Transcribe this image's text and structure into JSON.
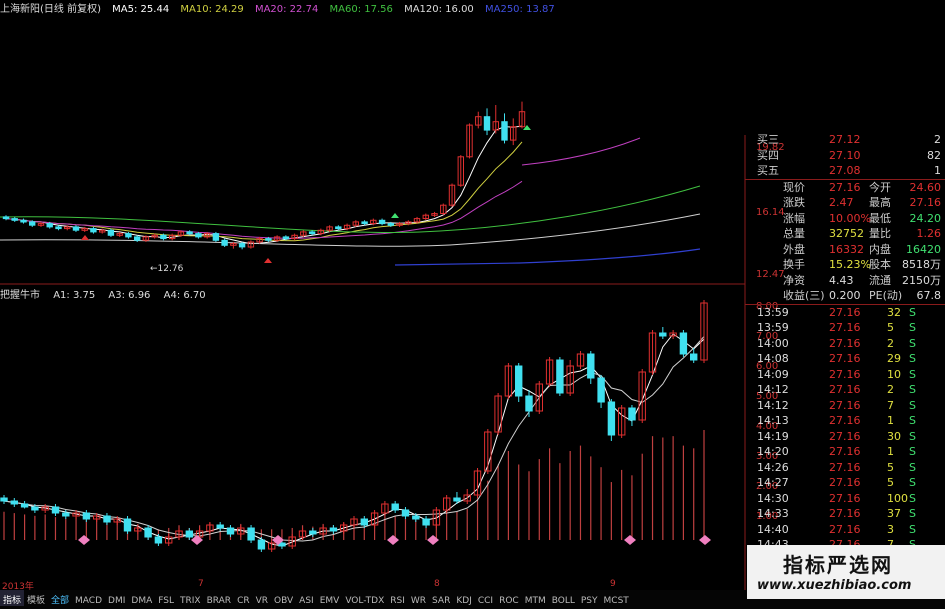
{
  "header": {
    "stock": "上海新阳(日线 前复权)",
    "ma5": "MA5: 25.44",
    "ma10": "MA10: 24.29",
    "ma20": "MA20: 22.74",
    "ma60": "MA60: 17.56",
    "ma120": "MA120: 16.00",
    "ma250": "MA250: 13.87"
  },
  "indicator_header": {
    "name": "把握牛市",
    "a1": "A1: 3.75",
    "a3": "A3: 6.96",
    "a4": "A4: 6.70"
  },
  "colors": {
    "up": "#e03030",
    "down": "#40e0f0",
    "ma5": "#ffffff",
    "ma10": "#d0d040",
    "ma20": "#c040c0",
    "ma60": "#40c040",
    "ma120": "#d0d0d0",
    "ma250": "#3040d0",
    "grid_line": "#8a1b1b"
  },
  "price_axis": [
    "19.82",
    "16.14",
    "12.47"
  ],
  "low_marker": "←12.76",
  "indicator_axis": [
    "8.00",
    "7.00",
    "6.00",
    "5.00",
    "4.00",
    "3.00",
    "2.00",
    "1.00"
  ],
  "x_labels": [
    "2013年",
    "7",
    "8",
    "9"
  ],
  "order_book": [
    {
      "label": "买三",
      "price": "27.12",
      "vol": "2"
    },
    {
      "label": "买四",
      "price": "27.10",
      "vol": "82"
    },
    {
      "label": "买五",
      "price": "27.08",
      "vol": "1"
    }
  ],
  "quote": [
    {
      "l1": "现价",
      "v1": "27.16",
      "l2": "今开",
      "v2": "24.60"
    },
    {
      "l1": "涨跌",
      "v1": "2.47",
      "l2": "最高",
      "v2": "27.16"
    },
    {
      "l1": "涨幅",
      "v1": "10.00%",
      "l2": "最低",
      "v2": "24.20"
    },
    {
      "l1": "总量",
      "v1": "32752",
      "l2": "量比",
      "v2": "1.26"
    },
    {
      "l1": "外盘",
      "v1": "16332",
      "l2": "内盘",
      "v2": "16420"
    },
    {
      "l1": "换手",
      "v1": "15.23%",
      "l2": "股本",
      "v2": "8518万"
    },
    {
      "l1": "净资",
      "v1": "4.43",
      "l2": "流通",
      "v2": "2150万"
    },
    {
      "l1": "收益(三)",
      "v1": "0.200",
      "l2": "PE(动)",
      "v2": "67.8"
    }
  ],
  "ticks": [
    {
      "time": "13:59",
      "price": "27.16",
      "vol": "32",
      "flag": "S"
    },
    {
      "time": "13:59",
      "price": "27.16",
      "vol": "5",
      "flag": "S"
    },
    {
      "time": "14:00",
      "price": "27.16",
      "vol": "2",
      "flag": "S"
    },
    {
      "time": "14:08",
      "price": "27.16",
      "vol": "29",
      "flag": "S"
    },
    {
      "time": "14:09",
      "price": "27.16",
      "vol": "10",
      "flag": "S"
    },
    {
      "time": "14:12",
      "price": "27.16",
      "vol": "2",
      "flag": "S"
    },
    {
      "time": "14:12",
      "price": "27.16",
      "vol": "7",
      "flag": "S"
    },
    {
      "time": "14:13",
      "price": "27.16",
      "vol": "1",
      "flag": "S"
    },
    {
      "time": "14:19",
      "price": "27.16",
      "vol": "30",
      "flag": "S"
    },
    {
      "time": "14:20",
      "price": "27.16",
      "vol": "1",
      "flag": "S"
    },
    {
      "time": "14:26",
      "price": "27.16",
      "vol": "5",
      "flag": "S"
    },
    {
      "time": "14:27",
      "price": "27.16",
      "vol": "5",
      "flag": "S"
    },
    {
      "time": "14:30",
      "price": "27.16",
      "vol": "100",
      "flag": "S"
    },
    {
      "time": "14:33",
      "price": "27.16",
      "vol": "37",
      "flag": "S"
    },
    {
      "time": "14:40",
      "price": "27.16",
      "vol": "3",
      "flag": "S"
    },
    {
      "time": "14:43",
      "price": "27.16",
      "vol": "7",
      "flag": "S"
    }
  ],
  "tabs": [
    "指标",
    "模板",
    "全部",
    "MACD",
    "DMI",
    "DMA",
    "FSL",
    "TRIX",
    "BRAR",
    "CR",
    "VR",
    "OBV",
    "ASI",
    "EMV",
    "VOL-TDX",
    "RSI",
    "WR",
    "SAR",
    "KDJ",
    "CCI",
    "ROC",
    "MTM",
    "BOLL",
    "PSY",
    "MCST"
  ],
  "watermark": {
    "title": "指标严选网",
    "url": "www.xuezhibiao.com"
  },
  "chart_data": {
    "type": "candlestick",
    "dates_shown": [
      "2013年",
      "7",
      "8",
      "9"
    ],
    "price_axis_ticks": [
      12.47,
      16.14,
      19.82
    ],
    "price_candles": [
      [
        14.7,
        14.6,
        14.8,
        14.5
      ],
      [
        14.6,
        14.5,
        14.7,
        14.4
      ],
      [
        14.5,
        14.4,
        14.6,
        14.3
      ],
      [
        14.4,
        14.2,
        14.5,
        14.1
      ],
      [
        14.2,
        14.3,
        14.4,
        14.1
      ],
      [
        14.3,
        14.1,
        14.4,
        14.0
      ],
      [
        14.1,
        14.0,
        14.2,
        13.9
      ],
      [
        14.0,
        14.1,
        14.2,
        13.9
      ],
      [
        14.1,
        13.9,
        14.2,
        13.8
      ],
      [
        13.9,
        14.0,
        14.1,
        13.8
      ],
      [
        14.0,
        13.8,
        14.1,
        13.7
      ],
      [
        13.8,
        13.9,
        14.0,
        13.7
      ],
      [
        13.9,
        13.6,
        14.0,
        13.5
      ],
      [
        13.6,
        13.7,
        13.8,
        13.5
      ],
      [
        13.7,
        13.5,
        13.8,
        13.4
      ],
      [
        13.5,
        13.3,
        13.6,
        13.2
      ],
      [
        13.3,
        13.5,
        13.6,
        13.2
      ],
      [
        13.5,
        13.6,
        13.7,
        13.4
      ],
      [
        13.6,
        13.4,
        13.7,
        13.3
      ],
      [
        13.4,
        13.6,
        13.7,
        13.3
      ],
      [
        13.6,
        13.8,
        13.9,
        13.5
      ],
      [
        13.8,
        13.7,
        13.9,
        13.6
      ],
      [
        13.7,
        13.5,
        13.8,
        13.4
      ],
      [
        13.5,
        13.7,
        13.8,
        13.4
      ],
      [
        13.7,
        13.3,
        13.8,
        13.2
      ],
      [
        13.3,
        13.0,
        13.4,
        12.9
      ],
      [
        13.0,
        13.1,
        13.2,
        12.8
      ],
      [
        13.1,
        12.9,
        13.2,
        12.76
      ],
      [
        12.9,
        13.2,
        13.3,
        12.8
      ],
      [
        13.2,
        13.4,
        13.5,
        13.1
      ],
      [
        13.4,
        13.3,
        13.5,
        13.2
      ],
      [
        13.3,
        13.5,
        13.6,
        13.2
      ],
      [
        13.5,
        13.4,
        13.6,
        13.3
      ],
      [
        13.4,
        13.6,
        13.7,
        13.3
      ],
      [
        13.6,
        13.8,
        13.9,
        13.5
      ],
      [
        13.8,
        13.7,
        13.9,
        13.6
      ],
      [
        13.7,
        13.9,
        14.0,
        13.6
      ],
      [
        13.9,
        14.1,
        14.2,
        13.8
      ],
      [
        14.1,
        14.0,
        14.2,
        13.9
      ],
      [
        14.0,
        14.2,
        14.3,
        13.9
      ],
      [
        14.2,
        14.4,
        14.5,
        14.1
      ],
      [
        14.4,
        14.3,
        14.5,
        14.2
      ],
      [
        14.3,
        14.5,
        14.6,
        14.2
      ],
      [
        14.5,
        14.3,
        14.6,
        14.2
      ],
      [
        14.3,
        14.2,
        14.4,
        14.1
      ],
      [
        14.2,
        14.3,
        14.4,
        14.1
      ],
      [
        14.3,
        14.4,
        14.5,
        14.2
      ],
      [
        14.4,
        14.6,
        14.7,
        14.3
      ],
      [
        14.6,
        14.8,
        14.9,
        14.5
      ],
      [
        14.8,
        14.9,
        15.0,
        14.7
      ],
      [
        14.9,
        15.4,
        15.5,
        14.8
      ],
      [
        15.4,
        16.6,
        16.7,
        15.3
      ],
      [
        16.6,
        18.3,
        18.4,
        16.5
      ],
      [
        18.3,
        20.2,
        20.3,
        18.2
      ],
      [
        20.2,
        20.7,
        21.0,
        20.0
      ],
      [
        20.7,
        19.9,
        21.2,
        19.6
      ],
      [
        19.9,
        20.4,
        21.4,
        19.7
      ],
      [
        20.4,
        19.3,
        20.9,
        19.1
      ],
      [
        19.3,
        20.1,
        20.6,
        19.0
      ],
      [
        20.1,
        21.0,
        21.6,
        20.0
      ]
    ],
    "indicator_axis_ticks": [
      1,
      2,
      3,
      4,
      5,
      6,
      7,
      8
    ],
    "indicator_candles": [
      [
        1.6,
        1.5,
        1.7,
        1.4
      ],
      [
        1.5,
        1.4,
        1.6,
        1.3
      ],
      [
        1.4,
        1.3,
        1.5,
        1.25
      ],
      [
        1.3,
        1.2,
        1.4,
        1.1
      ],
      [
        1.2,
        1.3,
        1.4,
        1.1
      ],
      [
        1.3,
        1.1,
        1.4,
        1.0
      ],
      [
        1.1,
        1.0,
        1.2,
        0.9
      ],
      [
        1.0,
        1.1,
        1.2,
        0.9
      ],
      [
        1.1,
        0.9,
        1.2,
        0.8
      ],
      [
        0.9,
        1.0,
        1.1,
        0.8
      ],
      [
        1.0,
        0.8,
        1.1,
        0.7
      ],
      [
        0.8,
        0.9,
        1.0,
        0.7
      ],
      [
        0.9,
        0.5,
        1.0,
        0.4
      ],
      [
        0.5,
        0.6,
        0.7,
        0.4
      ],
      [
        0.6,
        0.3,
        0.7,
        0.2
      ],
      [
        0.3,
        0.1,
        0.4,
        0.0
      ],
      [
        0.1,
        0.3,
        0.4,
        0.0
      ],
      [
        0.3,
        0.5,
        0.6,
        0.2
      ],
      [
        0.5,
        0.3,
        0.6,
        0.2
      ],
      [
        0.3,
        0.5,
        0.6,
        0.2
      ],
      [
        0.5,
        0.7,
        0.8,
        0.4
      ],
      [
        0.7,
        0.6,
        0.8,
        0.5
      ],
      [
        0.6,
        0.4,
        0.7,
        0.3
      ],
      [
        0.4,
        0.6,
        0.7,
        0.3
      ],
      [
        0.6,
        0.2,
        0.7,
        0.1
      ],
      [
        0.2,
        -0.1,
        0.3,
        -0.2
      ],
      [
        -0.1,
        0.1,
        0.2,
        -0.2
      ],
      [
        0.1,
        0.0,
        0.2,
        -0.1
      ],
      [
        0.0,
        0.3,
        0.4,
        -0.1
      ],
      [
        0.3,
        0.5,
        0.6,
        0.2
      ],
      [
        0.5,
        0.4,
        0.6,
        0.3
      ],
      [
        0.4,
        0.6,
        0.7,
        0.3
      ],
      [
        0.6,
        0.5,
        0.7,
        0.4
      ],
      [
        0.5,
        0.7,
        0.8,
        0.4
      ],
      [
        0.7,
        0.9,
        1.0,
        0.6
      ],
      [
        0.9,
        0.7,
        1.0,
        0.6
      ],
      [
        0.7,
        1.1,
        1.2,
        0.6
      ],
      [
        1.1,
        1.4,
        1.5,
        1.0
      ],
      [
        1.4,
        1.2,
        1.5,
        1.1
      ],
      [
        1.2,
        1.0,
        1.3,
        0.9
      ],
      [
        1.0,
        0.9,
        1.1,
        0.8
      ],
      [
        0.9,
        0.7,
        1.0,
        0.6
      ],
      [
        0.7,
        1.2,
        1.3,
        0.6
      ],
      [
        1.2,
        1.6,
        1.7,
        1.1
      ],
      [
        1.6,
        1.5,
        1.8,
        1.4
      ],
      [
        1.5,
        1.7,
        1.9,
        1.4
      ],
      [
        1.7,
        2.5,
        2.6,
        1.6
      ],
      [
        2.5,
        3.8,
        3.9,
        2.4
      ],
      [
        3.8,
        5.0,
        5.1,
        3.7
      ],
      [
        5.0,
        6.0,
        6.1,
        4.9
      ],
      [
        6.0,
        5.0,
        6.1,
        4.8
      ],
      [
        5.0,
        4.5,
        5.2,
        4.3
      ],
      [
        4.5,
        5.4,
        5.5,
        4.4
      ],
      [
        5.4,
        6.2,
        6.3,
        5.3
      ],
      [
        6.2,
        5.1,
        6.3,
        5.0
      ],
      [
        5.1,
        6.0,
        6.2,
        5.0
      ],
      [
        6.0,
        6.4,
        6.5,
        5.9
      ],
      [
        6.4,
        5.6,
        6.5,
        5.4
      ],
      [
        5.6,
        4.8,
        5.7,
        4.6
      ],
      [
        4.8,
        3.7,
        4.9,
        3.5
      ],
      [
        3.7,
        4.6,
        4.7,
        3.6
      ],
      [
        4.6,
        4.2,
        4.7,
        4.0
      ],
      [
        4.2,
        5.8,
        5.9,
        4.1
      ],
      [
        5.8,
        7.1,
        7.2,
        5.7
      ],
      [
        7.1,
        7.0,
        7.3,
        6.9
      ],
      [
        7.0,
        7.1,
        7.2,
        6.9
      ],
      [
        7.1,
        6.4,
        7.2,
        6.3
      ],
      [
        6.4,
        6.2,
        6.6,
        6.1
      ],
      [
        6.2,
        8.1,
        8.2,
        6.1
      ]
    ]
  }
}
